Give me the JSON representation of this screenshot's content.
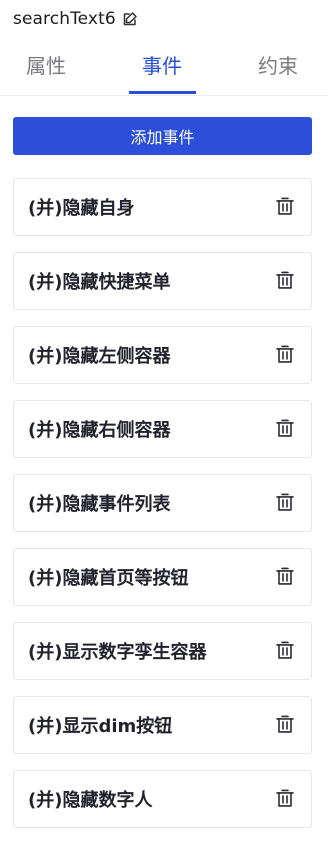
{
  "header": {
    "title": "searchText6",
    "edit_icon": "edit-icon"
  },
  "tabs": [
    {
      "label": "属性",
      "active": false
    },
    {
      "label": "事件",
      "active": true
    },
    {
      "label": "约束",
      "active": false
    }
  ],
  "add_button_label": "添加事件",
  "events": [
    {
      "label": "(并)隐藏自身",
      "icon": "trash-icon"
    },
    {
      "label": "(并)隐藏快捷菜单",
      "icon": "trash-icon"
    },
    {
      "label": "(并)隐藏左侧容器",
      "icon": "trash-icon"
    },
    {
      "label": "(并)隐藏右侧容器",
      "icon": "trash-icon"
    },
    {
      "label": "(并)隐藏事件列表",
      "icon": "trash-icon"
    },
    {
      "label": "(并)隐藏首页等按钮",
      "icon": "trash-icon"
    },
    {
      "label": "(并)显示数字孪生容器",
      "icon": "trash-icon"
    },
    {
      "label": "(并)显示dim按钮",
      "icon": "trash-icon"
    },
    {
      "label": "(并)隐藏数字人",
      "icon": "trash-icon"
    }
  ],
  "colors": {
    "accent": "#2b4fd8",
    "tab_inactive": "#7a7a82",
    "card_border": "#e6e6ea",
    "text": "#22222e"
  }
}
